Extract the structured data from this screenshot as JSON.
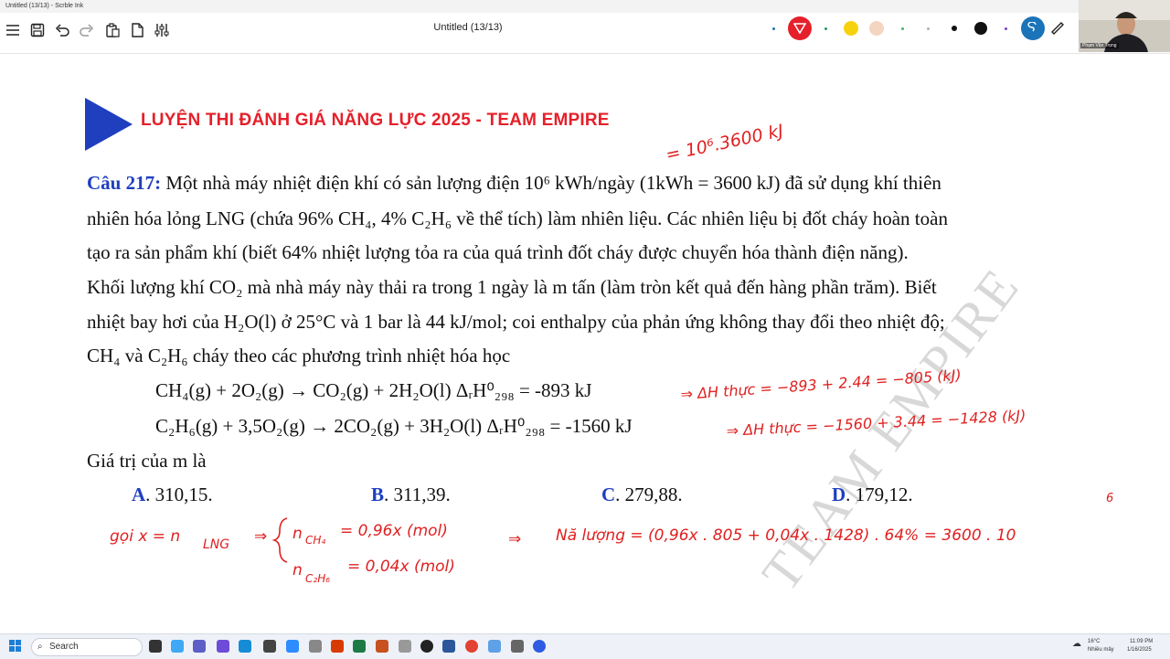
{
  "app": {
    "window_title": "Untitled (13/13) - Scrble Ink",
    "doc_title": "Untitled (13/13)"
  },
  "webcam": {
    "name": "Phạm Văn Trọng"
  },
  "colors": {
    "red": "#e5202a",
    "navy": "#1f3fbf",
    "ink": "#e02020",
    "pen_black": "#111111",
    "yellow": "#f6d20e",
    "peach": "#f3d5c0",
    "accent_blue": "#1b73b8"
  },
  "toolbar": {
    "icons": [
      "menu-icon",
      "save-icon",
      "undo-icon",
      "redo-icon",
      "clipboard-icon",
      "page-icon",
      "sliders-icon"
    ]
  },
  "banner": {
    "text": "LUYỆN THI ĐÁNH GIÁ NĂNG LỰC 2025 - TEAM EMPIRE"
  },
  "question": {
    "number": "Câu 217:",
    "line1": " Một nhà máy nhiệt điện khí có sản lượng điện 10⁶ kWh/ngày (1kWh = 3600 kJ) đã sử dụng khí thiên",
    "line2": "nhiên hóa lỏng LNG (chứa 96% CH₄, 4% C₂H₆ về thể tích) làm nhiên liệu. Các nhiên liệu bị đốt cháy hoàn toàn",
    "line3": "tạo ra sản phẩm khí (biết 64% nhiệt lượng tỏa ra của quá trình đốt cháy được chuyển hóa thành điện năng).",
    "line4": "Khối lượng khí CO₂ mà nhà máy này thải ra trong 1 ngày là m tấn (làm tròn kết quả đến hàng phần trăm). Biết",
    "line5": "nhiệt bay hơi của H₂O(l) ở 25°C và 1 bar là 44 kJ/mol; coi enthalpy của phản ứng không thay đổi theo nhiệt độ;",
    "line6": "CH₄ và C₂H₆ cháy theo các phương trình nhiệt hóa học",
    "eq1": "CH₄(g) + 2O₂(g) → CO₂(g) + 2H₂O(l) ΔᵣH⁰₂₉₈ = -893 kJ",
    "eq2": "C₂H₆(g) + 3,5O₂(g) → 2CO₂(g) + 3H₂O(l) ΔᵣH⁰₂₉₈ = -1560 kJ",
    "ask": "Giá trị của m là",
    "options": [
      {
        "letter": "A",
        "text": ". 310,15."
      },
      {
        "letter": "B",
        "text": ". 311,39."
      },
      {
        "letter": "C",
        "text": ". 279,88."
      },
      {
        "letter": "D",
        "text": ". 179,12."
      }
    ]
  },
  "handwriting": {
    "top": "= 10⁶.3600 kJ",
    "eq1_note": "⇒ ΔH thực = −893 + 2.44 = −805 (kJ)",
    "eq2_note": "⇒ ΔH thực = −1560 + 3.44 = −1428 (kJ)",
    "gọi": "gọi x = n",
    "lng": "LNG",
    "n_ch4": "n",
    "ch4_sub": "CH₄",
    "ch4_val": "= 0,96x (mol)",
    "n_c2h6": "n",
    "c2h6_sub": "C₂H₆",
    "c2h6_val": "= 0,04x (mol)",
    "arrow1": "⇒",
    "arrow2": "⇒",
    "energy": "Nă lượng = (0,96x . 805 + 0,04x . 1428) . 64% = 3600 . 10",
    "energy_exp": "6"
  },
  "watermark": "TEAM EMPIRE",
  "taskbar": {
    "search": "Search",
    "weather_temp": "16°C",
    "weather_desc": "Nhiều mây",
    "time": "11:09 PM",
    "date": "1/16/2025"
  }
}
